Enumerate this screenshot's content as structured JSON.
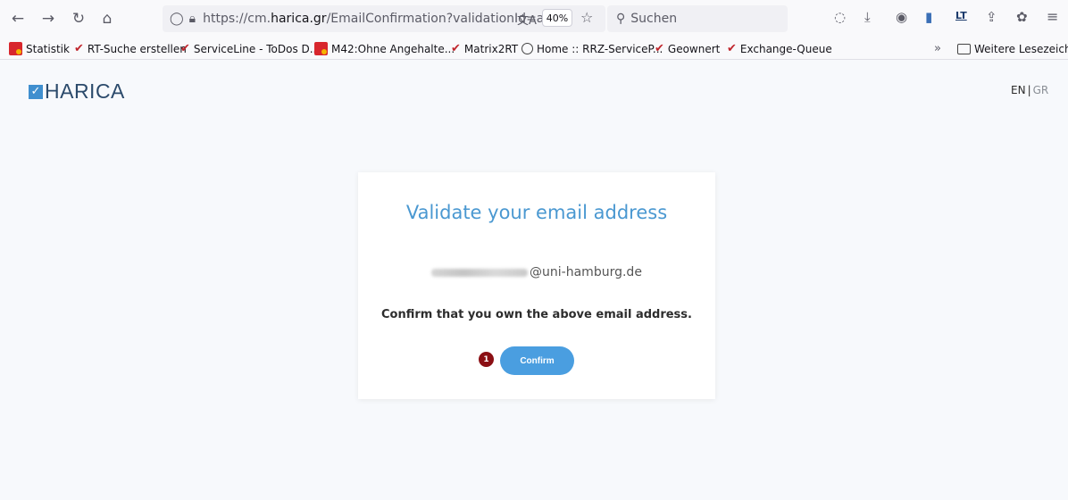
{
  "browser": {
    "url": {
      "prefix": "https://cm.",
      "host": "harica.gr",
      "path": "/EmailConfirmation?validationId=af6c"
    },
    "zoom": "40%",
    "search_placeholder": "Suchen"
  },
  "bookmarks": [
    {
      "label": "Statistik",
      "icon": "red-app-icon"
    },
    {
      "label": "RT-Suche erstellen",
      "icon": "check-icon"
    },
    {
      "label": "ServiceLine - ToDos D...",
      "icon": "check-icon"
    },
    {
      "label": "M42:Ohne Angehalte...",
      "icon": "red-app-icon"
    },
    {
      "label": "Matrix2RT",
      "icon": "check-icon"
    },
    {
      "label": "Home :: RRZ-ServiceP...",
      "icon": "globe-icon"
    },
    {
      "label": "Geownert",
      "icon": "check-icon"
    },
    {
      "label": "Exchange-Queue",
      "icon": "check-icon"
    }
  ],
  "bookmarks_more": "Weitere Lesezeichen",
  "page": {
    "logo": "HARICA",
    "lang_en": "EN",
    "lang_sep": "|",
    "lang_gr": "GR",
    "card": {
      "title": "Validate your email address",
      "email_domain": "@uni-hamburg.de",
      "confirm_text": "Confirm that you own the above email address.",
      "step_number": "1",
      "confirm_button": "Confirm"
    }
  },
  "colors": {
    "accent": "#4a9ee0",
    "title": "#4a98d1",
    "step_badge": "#8b0f14"
  }
}
